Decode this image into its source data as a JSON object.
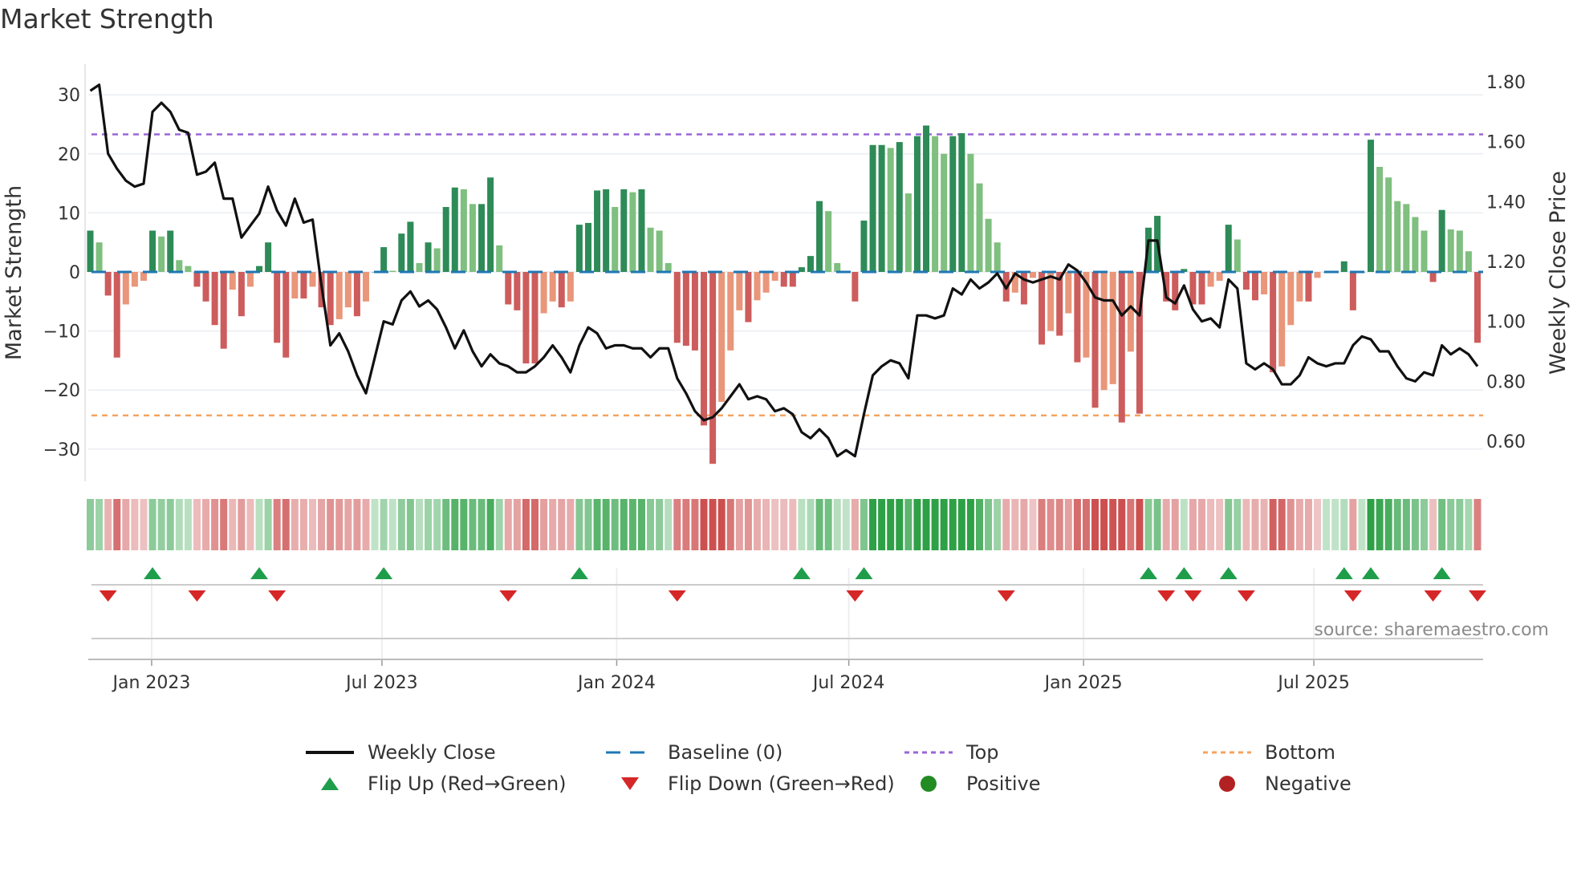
{
  "title": "Market Strength",
  "source": "source: sharemaestro.com",
  "legend": {
    "weekly_close": "Weekly Close",
    "baseline": "Baseline (0)",
    "top": "Top",
    "bottom": "Bottom",
    "flip_up": "Flip Up (Red→Green)",
    "flip_down": "Flip Down (Green→Red)",
    "positive": "Positive",
    "negative": "Negative"
  },
  "colors": {
    "rising_positive": "#2e8b57",
    "falling_positive": "#7fbf7f",
    "falling_negative": "#cd5c5c",
    "rising_negative": "#e9967a",
    "baseline": "#1f77b4",
    "top": "#9a66d6",
    "bottom": "#f4a460",
    "flip_up": "#1e9e4a",
    "flip_down": "#d62728",
    "positive_dot": "#228b22",
    "negative_dot": "#b22222",
    "price": "#111111"
  },
  "chart_data": {
    "type": "bar",
    "title": "Market Strength",
    "ylabel": "Market Strength",
    "y2label": "Weekly Close Price",
    "ylim": [
      -35,
      35
    ],
    "y2lim": [
      0.48,
      1.86
    ],
    "yticks": [
      "30",
      "20",
      "10",
      "0",
      "−10",
      "−20",
      "−30"
    ],
    "ytick_values": [
      30,
      20,
      10,
      0,
      -10,
      -20,
      -30
    ],
    "y2ticks": [
      "1.80",
      "1.60",
      "1.40",
      "1.20",
      "1.00",
      "0.80",
      "0.60"
    ],
    "y2tick_values": [
      1.8,
      1.6,
      1.4,
      1.2,
      1.0,
      0.8,
      0.6
    ],
    "xticks": [
      "Jan 2023",
      "Jul 2023",
      "Jan 2024",
      "Jul 2024",
      "Jan 2025",
      "Jul 2025"
    ],
    "xtick_weeks": [
      6.9,
      32.8,
      59.2,
      85.3,
      111.7,
      137.6
    ],
    "top_level": 23.3,
    "bottom_level": -24.3,
    "baseline": 0,
    "strength": [
      7,
      5,
      -4,
      -14.5,
      -5.5,
      -2.5,
      -1.5,
      7,
      6,
      7,
      2,
      1,
      -2.5,
      -5,
      -9,
      -13,
      -3,
      -7.5,
      -2.5,
      1,
      5,
      -12,
      -14.5,
      -4.5,
      -4.5,
      -2.5,
      -6,
      -9,
      -8,
      -6,
      -7.5,
      -5,
      0,
      4.2,
      0.2,
      6.5,
      8.5,
      1.5,
      5,
      4,
      11,
      14.3,
      14,
      11.5,
      11.5,
      16,
      4.5,
      -5.5,
      -6.5,
      -15.5,
      -15.5,
      -7,
      -5,
      -6,
      -5,
      8,
      8.3,
      13.8,
      14,
      11,
      14,
      13.5,
      14,
      7.5,
      7,
      1.5,
      -12,
      -12.5,
      -13.3,
      -26,
      -32.5,
      -22,
      -13.3,
      -6.5,
      -8.5,
      -4.8,
      -3.5,
      -1.5,
      -2.5,
      -2.5,
      0.8,
      2.7,
      12,
      10.3,
      1.5,
      0,
      -5,
      8.7,
      21.5,
      21.5,
      21,
      22,
      13.3,
      23,
      24.8,
      23,
      20,
      23,
      23.5,
      20,
      15,
      9,
      5,
      -5,
      -3.5,
      -5.5,
      -1,
      -12.3,
      -10,
      -10.8,
      -7,
      -15.3,
      -14.5,
      -23,
      -20,
      -19,
      -25.5,
      -13.5,
      -24,
      7.5,
      9.5,
      -5,
      -6.5,
      0.5,
      -5.5,
      -5.5,
      -2.5,
      -1.5,
      8,
      5.5,
      -3,
      -4.8,
      -3.8,
      -17,
      -16,
      -9,
      -5,
      -5,
      -1,
      0,
      0,
      1.8,
      -6.5,
      0,
      22.4,
      17.8,
      16,
      12,
      11.5,
      9.3,
      7,
      -1.7,
      10.5,
      7.2,
      7,
      3.5,
      -12
    ],
    "weekly_close": [
      1.77,
      1.79,
      1.56,
      1.51,
      1.47,
      1.45,
      1.46,
      1.7,
      1.73,
      1.7,
      1.64,
      1.63,
      1.49,
      1.5,
      1.53,
      1.41,
      1.41,
      1.28,
      1.32,
      1.36,
      1.45,
      1.37,
      1.32,
      1.41,
      1.33,
      1.34,
      1.12,
      0.92,
      0.96,
      0.9,
      0.82,
      0.76,
      0.88,
      1.0,
      0.99,
      1.07,
      1.1,
      1.05,
      1.07,
      1.04,
      0.98,
      0.91,
      0.97,
      0.9,
      0.85,
      0.89,
      0.86,
      0.85,
      0.83,
      0.83,
      0.85,
      0.88,
      0.92,
      0.88,
      0.83,
      0.92,
      0.98,
      0.96,
      0.91,
      0.92,
      0.92,
      0.91,
      0.91,
      0.88,
      0.91,
      0.91,
      0.81,
      0.76,
      0.7,
      0.67,
      0.68,
      0.71,
      0.75,
      0.79,
      0.74,
      0.75,
      0.74,
      0.7,
      0.71,
      0.69,
      0.63,
      0.61,
      0.64,
      0.61,
      0.55,
      0.57,
      0.55,
      0.69,
      0.82,
      0.85,
      0.87,
      0.86,
      0.81,
      1.02,
      1.02,
      1.01,
      1.02,
      1.11,
      1.09,
      1.14,
      1.11,
      1.13,
      1.16,
      1.11,
      1.16,
      1.14,
      1.13,
      1.14,
      1.15,
      1.14,
      1.19,
      1.17,
      1.13,
      1.08,
      1.07,
      1.07,
      1.02,
      1.05,
      1.02,
      1.27,
      1.27,
      1.08,
      1.06,
      1.12,
      1.04,
      1.0,
      1.01,
      0.98,
      1.14,
      1.11,
      0.86,
      0.84,
      0.86,
      0.84,
      0.79,
      0.79,
      0.82,
      0.88,
      0.86,
      0.85,
      0.86,
      0.86,
      0.92,
      0.95,
      0.94,
      0.9,
      0.9,
      0.85,
      0.81,
      0.8,
      0.83,
      0.82,
      0.92,
      0.89,
      0.91,
      0.89,
      0.85
    ]
  }
}
